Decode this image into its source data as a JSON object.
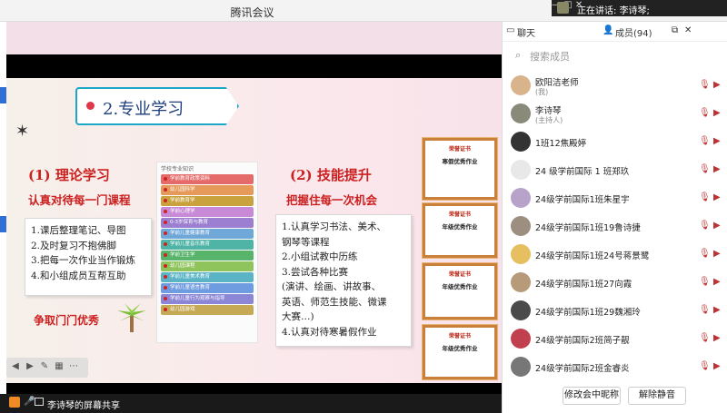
{
  "window": {
    "title": "腾讯会议",
    "controls": [
      "—",
      "□",
      "✕"
    ]
  },
  "speaking": {
    "prefix": "正在讲话:",
    "name": "李诗琴;"
  },
  "slide": {
    "heading": "2.专业学习",
    "left": {
      "title": "(1) 理论学习",
      "subtitle": "认真对待每一门课程",
      "items": [
        "1.课后整理笔记、导图",
        "2.及时复习不抱佛脚",
        "3.把每一次作业当作锻炼",
        "4.和小组成员互帮互助"
      ],
      "slogan": "争取门门优秀"
    },
    "courses": {
      "header": "学校专业知识",
      "items": [
        {
          "label": "学前教育政策资料",
          "color": "#e56b6b"
        },
        {
          "label": "幼儿园科学",
          "color": "#e59a5a"
        },
        {
          "label": "学前教育学",
          "color": "#caa23d"
        },
        {
          "label": "学前心理学",
          "color": "#c889d6"
        },
        {
          "label": "0-3岁保育与教育",
          "color": "#9c7fd0"
        },
        {
          "label": "学前儿童健康教育",
          "color": "#6fa7d9"
        },
        {
          "label": "学前儿童音乐教育",
          "color": "#4fb3a5"
        },
        {
          "label": "学前卫生学",
          "color": "#58b36b"
        },
        {
          "label": "幼儿园课程",
          "color": "#8fc35b"
        },
        {
          "label": "学前儿童美术教育",
          "color": "#5ab4c6"
        },
        {
          "label": "学前儿童语言教育",
          "color": "#6f9be0"
        },
        {
          "label": "学前儿童行为观察与指导",
          "color": "#8c86d6"
        },
        {
          "label": "幼儿园游戏",
          "color": "#c6a955"
        }
      ]
    },
    "right": {
      "title": "(2) 技能提升",
      "subtitle": "把握住每一次机会",
      "items": [
        "1.认真学习书法、美术、",
        "钢琴等课程",
        "2.小组试教中历练",
        "3.尝试各种比赛",
        "(演讲、绘画、讲故事、",
        "英语、师范生技能、微课",
        "大赛…)",
        "4.认真对待寒暑假作业"
      ]
    },
    "certificates": [
      {
        "header": "荣誉证书",
        "title": "寒假优秀作业"
      },
      {
        "header": "荣誉证书",
        "title": "年级优秀作业"
      },
      {
        "header": "荣誉证书",
        "title": "年级优秀作业"
      },
      {
        "header": "荣誉证书",
        "title": "年级优秀作业"
      }
    ]
  },
  "statusbar": {
    "label": "李诗琴的屏幕共享"
  },
  "panel": {
    "tab_chat": "聊天",
    "tab_members": "成员(94)",
    "search_placeholder": "搜索成员",
    "members": [
      {
        "name": "欧阳洁老师",
        "role": "(我)",
        "color": "#d9b38c"
      },
      {
        "name": "李诗琴",
        "role": "(主持人)",
        "color": "#8a8a7a"
      },
      {
        "name": "1班12焦殿婷",
        "role": "",
        "color": "#333333"
      },
      {
        "name": "24 级学前国际 1 班郑玖",
        "role": "",
        "color": "#e8e8e8"
      },
      {
        "name": "24级学前国际1班朱星宇",
        "role": "",
        "color": "#b7a3c9"
      },
      {
        "name": "24级学前国际1班19鲁诗捷",
        "role": "",
        "color": "#9c8f80"
      },
      {
        "name": "24级学前国际1班24号蒋景鹭",
        "role": "",
        "color": "#e6c060"
      },
      {
        "name": "24级学前国际1班27向霞",
        "role": "",
        "color": "#b69a7a"
      },
      {
        "name": "24级学前国际1班29魏湘玲",
        "role": "",
        "color": "#4a4a4a"
      },
      {
        "name": "24级学前国际2班简子靓",
        "role": "",
        "color": "#c04050"
      },
      {
        "name": "24级学前国际2班金睿炎",
        "role": "",
        "color": "#777777"
      }
    ],
    "btn_rename": "修改会中昵称",
    "btn_unmute": "解除静音"
  }
}
